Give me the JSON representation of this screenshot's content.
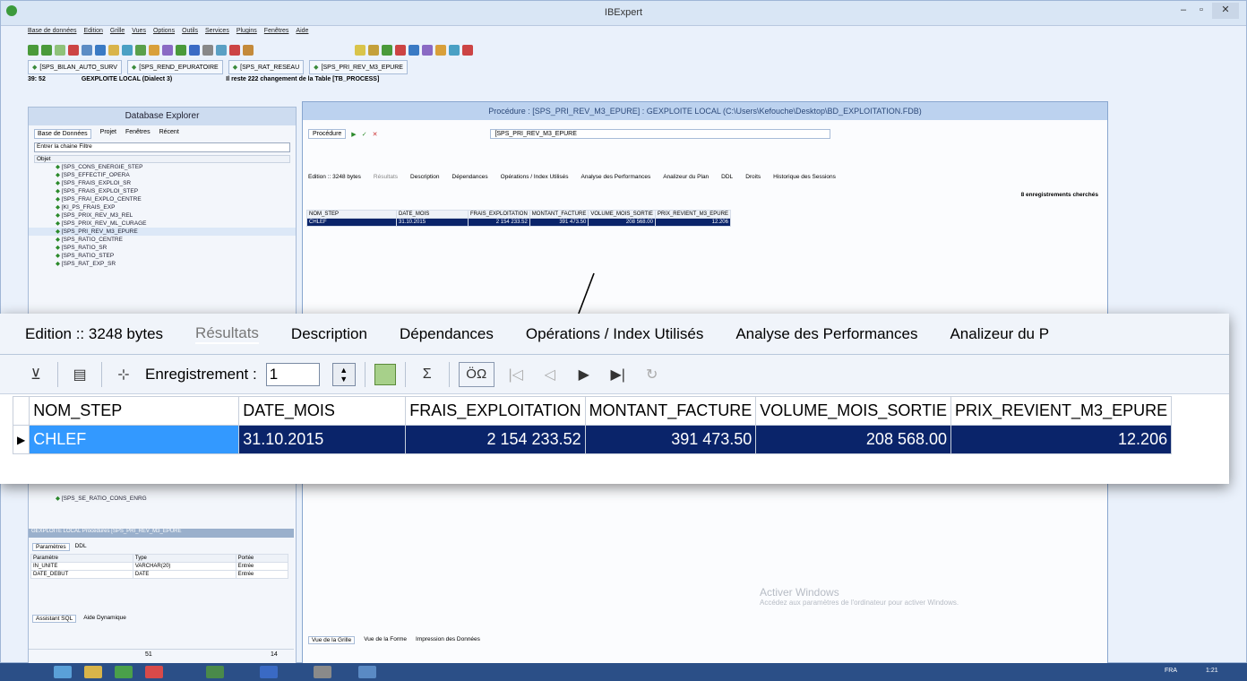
{
  "app": {
    "title": "IBExpert"
  },
  "menu": [
    "Base de données",
    "Edition",
    "Grille",
    "Vues",
    "Options",
    "Outils",
    "Services",
    "Plugins",
    "Fenêtres",
    "Aide"
  ],
  "open_tabs": [
    "[SPS_BILAN_AUTO_SURV",
    "[SPS_REND_EPURATOIRE",
    "[SPS_RAT_RESEAU",
    "[SPS_PRI_REV_M3_EPURE"
  ],
  "db_status": {
    "left": "39: 52",
    "db": "GEXPLOITE LOCAL (Dialect 3)",
    "message": "Il reste 222 changement de la Table [TB_PROCESS]"
  },
  "explorer": {
    "title": "Database Explorer",
    "tabs": [
      "Base de Données",
      "Projet",
      "Fenêtres",
      "Récent"
    ],
    "filter_placeholder": "Entrer la chaine Filtre",
    "objet_label": "Objet",
    "tree": [
      "[SPS_CONS_ENERGIE_STEP",
      "[SPS_EFFECTIF_OPERA",
      "[SPS_FRAIS_EXPLOI_SR",
      "[SPS_FRAIS_EXPLOI_STEP",
      "[SPS_FRAI_EXPLO_CENTRE",
      "[KI_PS_FRAIS_EXP",
      "[SPS_PRIX_REV_M3_REL",
      "[SPS_PRIX_REV_ML_CURAGE",
      "[SPS_PRI_REV_M3_EPURE",
      "[SPS_RATIO_CENTRE",
      "[SPS_RATIO_SR",
      "[SPS_RATIO_STEP",
      "[SPS_RAT_EXP_SR"
    ],
    "tree_bottom": [
      "[SPS_SE_RATIO_CONS_ENRG"
    ],
    "proc_label": "GEXPLOITE LOCAL Procédures [SPS_PRI_REV_M3_EPURE",
    "param_tabs": [
      "Paramètres",
      "DDL"
    ],
    "param_headers": [
      "Paramètre",
      "Type",
      "Portée"
    ],
    "params": [
      [
        "IN_UNITE",
        "VARCHAR(20)",
        "Entrée"
      ],
      [
        "DATE_DEBUT",
        "DATE",
        "Entrée"
      ]
    ],
    "assist_tabs": [
      "Assistant SQL",
      "Aide Dynamique"
    ],
    "status_left": "51",
    "status_right": "14"
  },
  "procedure": {
    "title": "Procédure : [SPS_PRI_REV_M3_EPURE] : GEXPLOITE LOCAL (C:\\Users\\Kefouche\\Desktop\\BD_EXPLOITATION.FDB)",
    "menu_label": "Procédure",
    "name": "[SPS_PRI_REV_M3_EPURE",
    "records_found": "8 enregistrements cherchés",
    "bottom_tabs": [
      "Vue de la Grille",
      "Vue de la Forme",
      "Impression des Données"
    ],
    "activation": {
      "title": "Activer Windows",
      "text": "Accédez aux paramètres de l'ordinateur pour activer Windows."
    }
  },
  "result_tabs": [
    "Edition :: 3248 bytes",
    "Résultats",
    "Description",
    "Dépendances",
    "Opérations / Index Utilisés",
    "Analyse des Performances",
    "Analizeur du Plan",
    "DDL",
    "Droits",
    "Historique des Sessions"
  ],
  "zoom_tabs": [
    "Edition :: 3248 bytes",
    "Résultats",
    "Description",
    "Dépendances",
    "Opérations / Index Utilisés",
    "Analyse des Performances",
    "Analizeur du P"
  ],
  "toolbar": {
    "record_label": "Enregistrement :",
    "record_value": "1"
  },
  "grid": {
    "headers": [
      "NOM_STEP",
      "DATE_MOIS",
      "FRAIS_EXPLOITATION",
      "MONTANT_FACTURE",
      "VOLUME_MOIS_SORTIE",
      "PRIX_REVIENT_M3_EPURE"
    ],
    "rows": [
      [
        "CHLEF",
        "31.10.2015",
        "2 154 233.52",
        "391 473.50",
        "208 568.00",
        "12.206"
      ]
    ]
  },
  "taskbar": {
    "lang": "FRA",
    "time": "1:21"
  },
  "colors": {
    "selection": "#0a246a",
    "cell_focus": "#3399ff",
    "accent": "#cddcf0"
  }
}
